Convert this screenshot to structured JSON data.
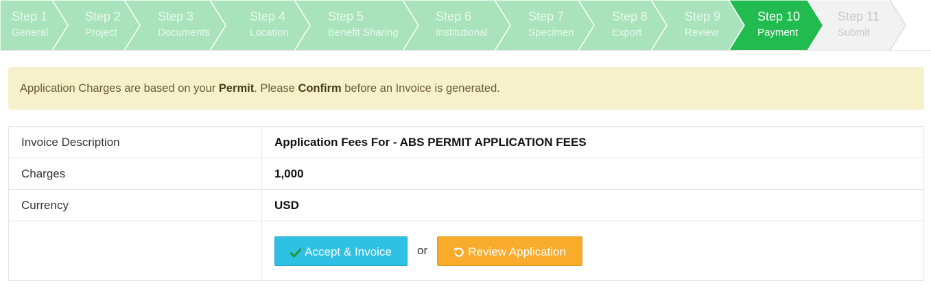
{
  "wizard": {
    "colors": {
      "done": "#a8e3bb",
      "current": "#22bb4f",
      "todo": "#f2f2f2",
      "divider": "#ffffff"
    },
    "steps": [
      {
        "label": "Step 1",
        "sub": "General",
        "state": "done"
      },
      {
        "label": "Step 2",
        "sub": "Project",
        "state": "done"
      },
      {
        "label": "Step 3",
        "sub": "Documents",
        "state": "done"
      },
      {
        "label": "Step 4",
        "sub": "Location",
        "state": "done"
      },
      {
        "label": "Step 5",
        "sub": "Benefit Sharing",
        "state": "done"
      },
      {
        "label": "Step 6",
        "sub": "Institutional",
        "state": "done"
      },
      {
        "label": "Step 7",
        "sub": "Specimen",
        "state": "done"
      },
      {
        "label": "Step 8",
        "sub": "Export",
        "state": "done"
      },
      {
        "label": "Step 9",
        "sub": "Review",
        "state": "done"
      },
      {
        "label": "Step 10",
        "sub": "Payment",
        "state": "current"
      },
      {
        "label": "Step 11",
        "sub": "Submit",
        "state": "todo"
      }
    ]
  },
  "alert": {
    "prefix": "Application Charges are based on your ",
    "bold1": "Permit",
    "middle": ". Please ",
    "bold2": "Confirm",
    "suffix": " before an Invoice is generated."
  },
  "invoice": {
    "rows": [
      {
        "label": "Invoice Description",
        "value": "Application Fees For - ABS PERMIT APPLICATION FEES"
      },
      {
        "label": "Charges",
        "value": "1,000"
      },
      {
        "label": "Currency",
        "value": "USD"
      }
    ],
    "accept_label": "Accept & Invoice",
    "accept_icon": "check-icon",
    "or_label": "or",
    "review_label": "Review Application",
    "review_icon": "undo-icon"
  }
}
